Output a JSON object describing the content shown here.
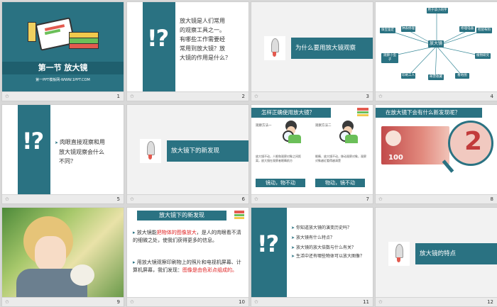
{
  "slides": [
    {
      "number": "1",
      "title": "第一节 放大镜",
      "subtitle": "第一PPT模板网-WWW.1PPT.COM"
    },
    {
      "number": "2",
      "symbol": "!?",
      "lines": [
        "放大镜是人们常用",
        "的观察工具之一。",
        "有哪些工作需要经",
        "常用到放大镜？放",
        "大镜的作用是什么？"
      ]
    },
    {
      "number": "3",
      "banner": "为什么要用放大镜观察"
    },
    {
      "number": "4",
      "center": "放大镜",
      "nodes": [
        "用于读小的字",
        "钟表修理",
        "珠宝鉴定",
        "修理电器",
        "检验布料",
        "观察小虫子",
        "植物研究",
        "印刷工人",
        "邮票收藏",
        "看地图"
      ]
    },
    {
      "number": "5",
      "symbol": "!?",
      "lines": [
        "肉眼直接观察和用",
        "放大镜观察会什么",
        "不同？"
      ]
    },
    {
      "number": "6",
      "banner": "放大镜下的新发现"
    },
    {
      "number": "7",
      "title": "怎样正确使用放大镜？",
      "method1": "观察方法一",
      "method2": "观察方法二",
      "desc1": "放大镜不动，人眼和观察对象之间距离，放大镜在观察者眼睛前方",
      "desc2": "眼睛、放大镜不动，移动观察对象，观察对象越近看得越清楚",
      "pill1": "镜动，物不动",
      "pill2": "物动，镜不动"
    },
    {
      "number": "8",
      "title": "在放大镜下会有什么新发现呢？",
      "money": "100",
      "zoom": "2"
    },
    {
      "number": "9"
    },
    {
      "number": "10",
      "title": "放大镜下的新发现",
      "p1a": "放大镜能",
      "p1b": "把物体的图像放大",
      "p1c": "，是人的肉眼看不清的细微之处，使我们获得更多的信息。",
      "p2a": "用放大镜观察印刷物上的照片和电视机屏幕、计算机屏幕，我们发现：",
      "p2b": "图像是由色彩点组成的。"
    },
    {
      "number": "11",
      "symbol": "!?",
      "lines": [
        "你知道放大镜的演变历史吗？",
        "放大镜有什么特点？",
        "放大镜的放大倍数与什么有关？",
        "生活中还有哪些物体可以放大图像？"
      ]
    },
    {
      "number": "12",
      "banner": "放大镜的特点"
    }
  ]
}
